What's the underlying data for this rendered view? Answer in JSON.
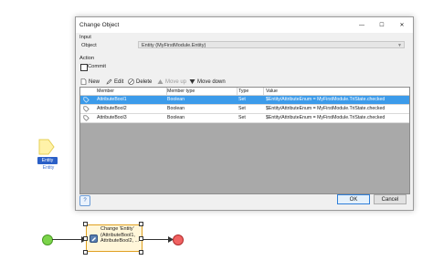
{
  "canvas": {
    "entity": {
      "badge_label": "Entity",
      "subtitle": "Entity"
    },
    "activity": {
      "label": "Change 'Entity' (AttributeBool1, AttributeBool2, ..."
    },
    "colors": {
      "entity_shape": "#fff2a8",
      "start": "#7bd44a",
      "end": "#f06262",
      "activity_border": "#e0a020"
    }
  },
  "dialog": {
    "title": "Change Object",
    "window_controls": {
      "minimize": "—",
      "maximize": "☐",
      "close": "✕"
    },
    "input": {
      "section_label": "Input",
      "object_label": "Object",
      "object_value": "Entity (MyFirstModule.Entity)"
    },
    "action": {
      "section_label": "Action",
      "commit_label": "Commit",
      "commit_checked": false
    },
    "toolbar": {
      "new": "New",
      "edit": "Edit",
      "delete": "Delete",
      "move_up": "Move up",
      "move_down": "Move down"
    },
    "grid": {
      "columns": [
        "Member",
        "Member type",
        "Type",
        "Value"
      ],
      "rows": [
        {
          "member": "AttributeBool1",
          "member_type": "Boolean",
          "type": "Set",
          "value": "$Entity/AttributeEnum = MyFirstModule.TriState.checked",
          "selected": true
        },
        {
          "member": "AttributeBool2",
          "member_type": "Boolean",
          "type": "Set",
          "value": "$Entity/AttributeEnum = MyFirstModule.TriState.checked",
          "selected": false
        },
        {
          "member": "AttributeBool3",
          "member_type": "Boolean",
          "type": "Set",
          "value": "$Entity/AttributeEnum = MyFirstModule.TriState.checked",
          "selected": false
        }
      ]
    },
    "footer": {
      "help": "?",
      "ok": "OK",
      "cancel": "Cancel"
    },
    "colors": {
      "selection": "#3c9bea",
      "grid_empty": "#a9a9a9"
    }
  }
}
